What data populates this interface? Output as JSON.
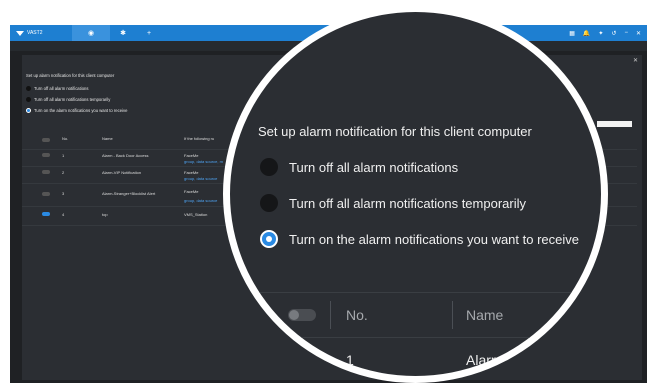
{
  "app": {
    "brand": "VAST2",
    "tabs": [
      {
        "icon": "eye-icon",
        "glyph": "◉",
        "active": true
      },
      {
        "icon": "gear-icon",
        "glyph": "✱",
        "active": false
      },
      {
        "icon": "plus-icon",
        "glyph": "+",
        "active": false
      }
    ],
    "right_glyphs": [
      "▦",
      "🔔",
      "✦",
      "↺",
      "−",
      "✕"
    ]
  },
  "settings": {
    "title": "Set up alarm notification for this client computer",
    "options": [
      {
        "label": "Turn off all alarm notifications",
        "selected": false
      },
      {
        "label": "Turn off all alarm notifications temporarily",
        "selected": false
      },
      {
        "label": "Turn on the alarm notifications you want to receive",
        "selected": true
      }
    ]
  },
  "table": {
    "headers": {
      "no": "No.",
      "name": "Name",
      "rule": "If the following ru"
    },
    "rows": [
      {
        "no": "1",
        "name": "Alarm - Back Door Access",
        "rule": "FaceMe",
        "rule2": "group, data source, m",
        "enabled": false
      },
      {
        "no": "2",
        "name": "Alarm-VIP Notification",
        "rule": "FaceMe",
        "rule2": "group, data source",
        "enabled": false
      },
      {
        "no": "3",
        "name": "Alarm-Stranger+Blocklist Alert",
        "rule": "FaceMe",
        "rule2": "group, data source",
        "enabled": false
      },
      {
        "no": "4",
        "name": "top",
        "rule": "VMS_Station",
        "rule2": "",
        "enabled": true
      }
    ]
  },
  "zoom": {
    "row_no": "1",
    "row_name": "Alarm - Ba"
  },
  "colors": {
    "accent": "#1e7fd1",
    "radio_selected": "#2a8ae3",
    "panel": "#2b2e33",
    "link": "#4ea3f2"
  }
}
